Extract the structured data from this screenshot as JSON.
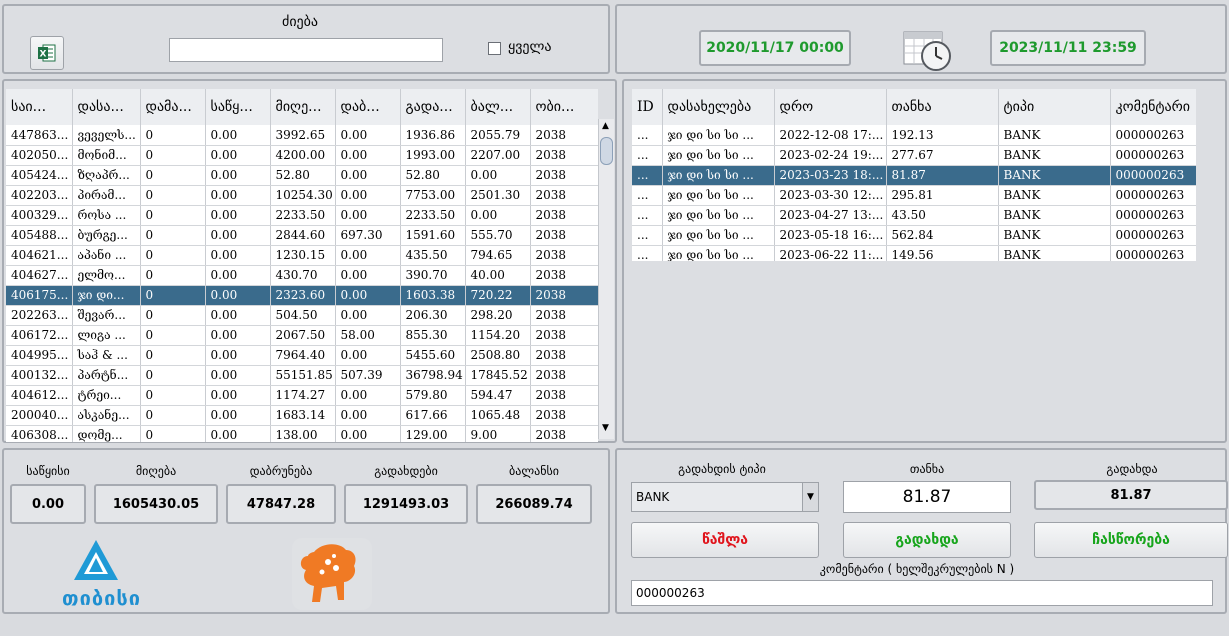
{
  "search": {
    "label": "ძიება",
    "value": ""
  },
  "all_checkbox": {
    "label": "ყველა",
    "checked": false
  },
  "dates": {
    "from": "2020/11/17 00:00",
    "to": "2023/11/11 23:59"
  },
  "left_table": {
    "columns": [
      "საი...",
      "დასა...",
      "დამა...",
      "საწყ...",
      "მიღე...",
      "დაბ...",
      "გადა...",
      "ბალ...",
      "ობი..."
    ],
    "rows": [
      [
        "447863...",
        "ვეველს...",
        "0",
        "0.00",
        "3992.65",
        "0.00",
        "1936.86",
        "2055.79",
        "2038"
      ],
      [
        "402050...",
        "მონიმ...",
        "0",
        "0.00",
        "4200.00",
        "0.00",
        "1993.00",
        "2207.00",
        "2038"
      ],
      [
        "405424...",
        "ზღაპრ...",
        "0",
        "0.00",
        "52.80",
        "0.00",
        "52.80",
        "0.00",
        "2038"
      ],
      [
        "402203...",
        "პირამ...",
        "0",
        "0.00",
        "10254.30",
        "0.00",
        "7753.00",
        "2501.30",
        "2038"
      ],
      [
        "400329...",
        "როსა ...",
        "0",
        "0.00",
        "2233.50",
        "0.00",
        "2233.50",
        "0.00",
        "2038"
      ],
      [
        "405488...",
        "ბურგე...",
        "0",
        "0.00",
        "2844.60",
        "697.30",
        "1591.60",
        "555.70",
        "2038"
      ],
      [
        "404621...",
        "აპანი ...",
        "0",
        "0.00",
        "1230.15",
        "0.00",
        "435.50",
        "794.65",
        "2038"
      ],
      [
        "404627...",
        "ელმო...",
        "0",
        "0.00",
        "430.70",
        "0.00",
        "390.70",
        "40.00",
        "2038"
      ],
      [
        "406175...",
        "ჯი დი...",
        "0",
        "0.00",
        "2323.60",
        "0.00",
        "1603.38",
        "720.22",
        "2038"
      ],
      [
        "202263...",
        "შევარ...",
        "0",
        "0.00",
        "504.50",
        "0.00",
        "206.30",
        "298.20",
        "2038"
      ],
      [
        "406172...",
        "ლიგა ...",
        "0",
        "0.00",
        "2067.50",
        "58.00",
        "855.30",
        "1154.20",
        "2038"
      ],
      [
        "404995...",
        "საჰ & ...",
        "0",
        "0.00",
        "7964.40",
        "0.00",
        "5455.60",
        "2508.80",
        "2038"
      ],
      [
        "400132...",
        "პარტნ...",
        "0",
        "0.00",
        "55151.85",
        "507.39",
        "36798.94",
        "17845.52",
        "2038"
      ],
      [
        "404612...",
        "ტრეი...",
        "0",
        "0.00",
        "1174.27",
        "0.00",
        "579.80",
        "594.47",
        "2038"
      ],
      [
        "200040...",
        "ასკანე...",
        "0",
        "0.00",
        "1683.14",
        "0.00",
        "617.66",
        "1065.48",
        "2038"
      ],
      [
        "406308...",
        "დომე...",
        "0",
        "0.00",
        "138.00",
        "0.00",
        "129.00",
        "9.00",
        "2038"
      ]
    ],
    "selected_row": 8
  },
  "right_table": {
    "columns": [
      "ID",
      "დასახელება",
      "დრო",
      "თანხა",
      "ტიპი",
      "კომენტარი"
    ],
    "rows": [
      [
        "...",
        "ჯი დი სი სი ...",
        "2022-12-08 17:...",
        "192.13",
        "BANK",
        "000000263"
      ],
      [
        "...",
        "ჯი დი სი სი ...",
        "2023-02-24 19:...",
        "277.67",
        "BANK",
        "000000263"
      ],
      [
        "...",
        "ჯი დი სი სი ...",
        "2023-03-23 18:...",
        "81.87",
        "BANK",
        "000000263"
      ],
      [
        "...",
        "ჯი დი სი სი ...",
        "2023-03-30 12:...",
        "295.81",
        "BANK",
        "000000263"
      ],
      [
        "...",
        "ჯი დი სი სი ...",
        "2023-04-27 13:...",
        "43.50",
        "BANK",
        "000000263"
      ],
      [
        "...",
        "ჯი დი სი სი ...",
        "2023-05-18 16:...",
        "562.84",
        "BANK",
        "000000263"
      ],
      [
        "...",
        "ჯი დი სი სი ...",
        "2023-06-22 11:...",
        "149.56",
        "BANK",
        "000000263"
      ]
    ],
    "selected_row": 2
  },
  "summary": {
    "start_label": "საწყისი",
    "start": "0.00",
    "received_label": "მიღება",
    "received": "1605430.05",
    "returns_label": "დაბრუნება",
    "returns": "47847.28",
    "payments_label": "გადახდები",
    "payments": "1291493.03",
    "balance_label": "ბალანსი",
    "balance": "266089.74"
  },
  "logo": {
    "text": "თიბისი"
  },
  "payment": {
    "type_label": "გადახდის ტიპი",
    "type_value": "BANK",
    "amount_label": "თანხა",
    "amount_value": "81.87",
    "paid_label": "გადახდა",
    "paid_value": "81.87",
    "delete_label": "წაშლა",
    "pay_label": "გადახდა",
    "save_label": "ჩასწორება",
    "comment_label": "კომენტარი ( ხელშეკრულების N )",
    "comment_value": "000000263"
  },
  "colors": {
    "selection": "#3a6b8c",
    "date_text": "#1f9a2e",
    "delete_text": "#e0141c",
    "green_text": "#17a51c"
  }
}
